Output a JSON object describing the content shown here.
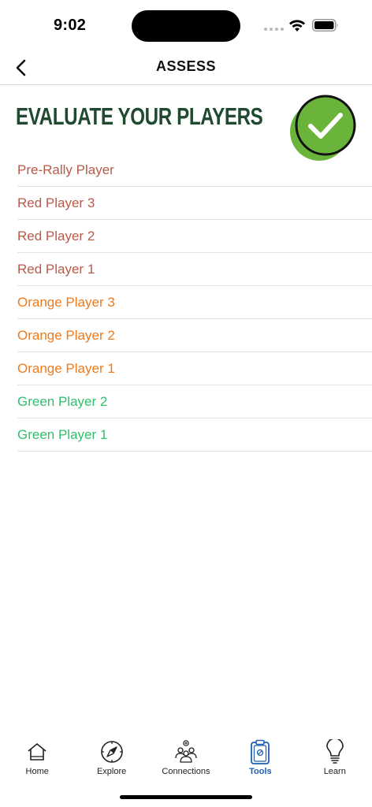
{
  "status_bar": {
    "time": "9:02"
  },
  "nav": {
    "title": "ASSESS"
  },
  "header": {
    "title": "EVALUATE YOUR PLAYERS"
  },
  "colors": {
    "red_level": "#b85a4a",
    "orange_level": "#ee7a1c",
    "green_level": "#2fbf6d",
    "title_green": "#1f4a30",
    "tab_active": "#1e5fb3",
    "badge_green": "#6ab43c"
  },
  "players": [
    {
      "label": "Pre-Rally Player",
      "color": "#b85a4a"
    },
    {
      "label": "Red Player 3",
      "color": "#b85a4a"
    },
    {
      "label": "Red Player 2",
      "color": "#b85a4a"
    },
    {
      "label": "Red Player 1",
      "color": "#b85a4a"
    },
    {
      "label": "Orange Player 3",
      "color": "#ee7a1c"
    },
    {
      "label": "Orange Player 2",
      "color": "#ee7a1c"
    },
    {
      "label": "Orange Player 1",
      "color": "#ee7a1c"
    },
    {
      "label": "Green Player 2",
      "color": "#2fbf6d"
    },
    {
      "label": "Green Player 1",
      "color": "#2fbf6d"
    }
  ],
  "tabs": [
    {
      "label": "Home",
      "icon": "home-icon",
      "active": false
    },
    {
      "label": "Explore",
      "icon": "compass-icon",
      "active": false
    },
    {
      "label": "Connections",
      "icon": "people-icon",
      "active": false
    },
    {
      "label": "Tools",
      "icon": "clipboard-icon",
      "active": true
    },
    {
      "label": "Learn",
      "icon": "lightbulb-icon",
      "active": false
    }
  ]
}
